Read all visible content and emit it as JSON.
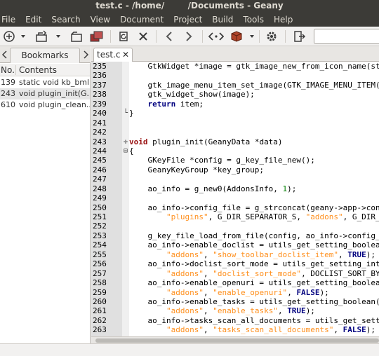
{
  "window": {
    "title": "test.c - /home/        /Documents - Geany"
  },
  "menu": [
    "File",
    "Edit",
    "Search",
    "View",
    "Document",
    "Project",
    "Build",
    "Tools",
    "Help"
  ],
  "sidebar": {
    "tab_label": "Bookmarks",
    "columns": {
      "no": "No.",
      "contents": "Contents"
    },
    "rows": [
      {
        "no": "139",
        "text": "static void kb_bml..."
      },
      {
        "no": "243",
        "text": "void plugin_init(G..."
      },
      {
        "no": "610",
        "text": "void plugin_clean..."
      }
    ]
  },
  "editor": {
    "tab_label": "test.c",
    "tab_close": "✕",
    "lines": [
      {
        "n": "235",
        "f": "",
        "segs": [
          [
            "",
            "    GtkWidget *image = gtk_image_new_from_icon_name(stock"
          ]
        ]
      },
      {
        "n": "236",
        "f": "",
        "segs": []
      },
      {
        "n": "237",
        "f": "",
        "segs": [
          [
            "",
            "    gtk_image_menu_item_set_image(GTK_IMAGE_MENU_ITEM(ite"
          ]
        ]
      },
      {
        "n": "238",
        "f": "",
        "segs": [
          [
            "",
            "    gtk_widget_show(image);"
          ]
        ]
      },
      {
        "n": "239",
        "f": "",
        "segs": [
          [
            "",
            "    "
          ],
          [
            "kw",
            "return"
          ],
          [
            "",
            " item;"
          ]
        ]
      },
      {
        "n": "240",
        "f": "└",
        "segs": [
          [
            "",
            "}"
          ]
        ]
      },
      {
        "n": "241",
        "f": "",
        "segs": []
      },
      {
        "n": "242",
        "f": "",
        "segs": []
      },
      {
        "n": "243",
        "f": "✛",
        "segs": [
          [
            "ty",
            "void"
          ],
          [
            "",
            " plugin_init(GeanyData *data)"
          ]
        ]
      },
      {
        "n": "244",
        "f": "⊟",
        "segs": [
          [
            "",
            "{"
          ]
        ]
      },
      {
        "n": "245",
        "f": "",
        "segs": [
          [
            "",
            "    GKeyFile *config = g_key_file_new();"
          ]
        ]
      },
      {
        "n": "246",
        "f": "",
        "segs": [
          [
            "",
            "    GeanyKeyGroup *key_group;"
          ]
        ]
      },
      {
        "n": "247",
        "f": "",
        "segs": []
      },
      {
        "n": "248",
        "f": "",
        "segs": [
          [
            "",
            "    ao_info = g_new0(AddonsInfo, "
          ],
          [
            "num",
            "1"
          ],
          [
            "",
            ");"
          ]
        ]
      },
      {
        "n": "249",
        "f": "",
        "segs": []
      },
      {
        "n": "250",
        "f": "",
        "segs": [
          [
            "",
            "    ao_info->config_file = g_strconcat(geany->app->config"
          ]
        ]
      },
      {
        "n": "251",
        "f": "",
        "segs": [
          [
            "",
            "        "
          ],
          [
            "str",
            "\"plugins\""
          ],
          [
            "",
            ", G_DIR_SEPARATOR_S, "
          ],
          [
            "str",
            "\"addons\""
          ],
          [
            "",
            ", G_DIR_SEPAR"
          ]
        ]
      },
      {
        "n": "252",
        "f": "",
        "segs": []
      },
      {
        "n": "253",
        "f": "",
        "segs": [
          [
            "",
            "    g_key_file_load_from_file(config, ao_info->config_fil"
          ]
        ]
      },
      {
        "n": "254",
        "f": "",
        "segs": [
          [
            "",
            "    ao_info->enable_doclist = utils_get_setting_boolean(c"
          ]
        ]
      },
      {
        "n": "255",
        "f": "",
        "segs": [
          [
            "",
            "        "
          ],
          [
            "str",
            "\"addons\""
          ],
          [
            "",
            ", "
          ],
          [
            "str",
            "\"show_toolbar_doclist_item\""
          ],
          [
            "",
            ", "
          ],
          [
            "kw",
            "TRUE"
          ],
          [
            "",
            ");"
          ]
        ]
      },
      {
        "n": "256",
        "f": "",
        "segs": [
          [
            "",
            "    ao_info->doclist_sort_mode = utils_get_setting_intege"
          ]
        ]
      },
      {
        "n": "257",
        "f": "",
        "segs": [
          [
            "",
            "        "
          ],
          [
            "str",
            "\"addons\""
          ],
          [
            "",
            ", "
          ],
          [
            "str",
            "\"doclist_sort_mode\""
          ],
          [
            "",
            ", DOCLIST_SORT_BY_TA"
          ]
        ]
      },
      {
        "n": "258",
        "f": "",
        "segs": [
          [
            "",
            "    ao_info->enable_openuri = utils_get_setting_boolean(c"
          ]
        ]
      },
      {
        "n": "259",
        "f": "",
        "segs": [
          [
            "",
            "        "
          ],
          [
            "str",
            "\"addons\""
          ],
          [
            "",
            ", "
          ],
          [
            "str",
            "\"enable_openuri\""
          ],
          [
            "",
            ", "
          ],
          [
            "kw",
            "FALSE"
          ],
          [
            "",
            ");"
          ]
        ]
      },
      {
        "n": "260",
        "f": "",
        "segs": [
          [
            "",
            "    ao_info->enable_tasks = utils_get_setting_boolean(con"
          ]
        ]
      },
      {
        "n": "261",
        "f": "",
        "segs": [
          [
            "",
            "        "
          ],
          [
            "str",
            "\"addons\""
          ],
          [
            "",
            ", "
          ],
          [
            "str",
            "\"enable_tasks\""
          ],
          [
            "",
            ", "
          ],
          [
            "kw",
            "TRUE"
          ],
          [
            "",
            ");"
          ]
        ]
      },
      {
        "n": "262",
        "f": "",
        "segs": [
          [
            "",
            "    ao_info->tasks_scan_all_documents = utils_get_setting"
          ]
        ]
      },
      {
        "n": "263",
        "f": "",
        "segs": [
          [
            "",
            "        "
          ],
          [
            "str",
            "\"addons\""
          ],
          [
            "",
            ", "
          ],
          [
            "str",
            "\"tasks_scan_all_documents\""
          ],
          [
            "",
            ", "
          ],
          [
            "kw",
            "FALSE"
          ],
          [
            "",
            ");"
          ]
        ]
      }
    ]
  },
  "toolbar": {
    "icons": [
      "new-file-icon",
      "open-file-icon",
      "save-icon",
      "save-all-icon",
      "revert-icon",
      "close-file-icon",
      "back-icon",
      "forward-icon",
      "compile-icon",
      "build-icon",
      "preferences-icon"
    ]
  },
  "colors": {
    "keyword": "#00007f",
    "type": "#991111",
    "string": "#ff901e",
    "number": "#007f00",
    "gutter": "#e0e0e0"
  }
}
